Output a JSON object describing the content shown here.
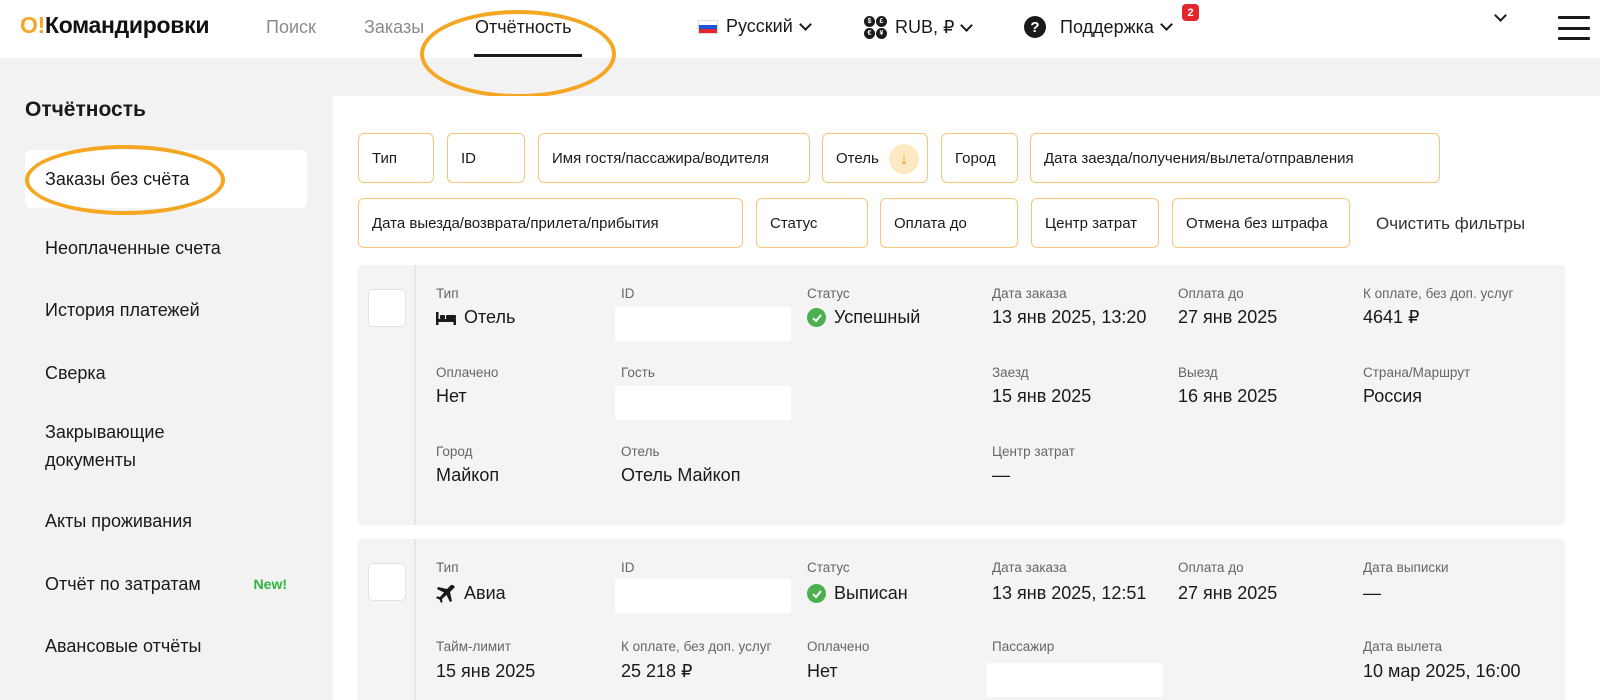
{
  "header": {
    "logo_mark": "О!",
    "logo_text": "Командировки",
    "nav": [
      "Поиск",
      "Заказы",
      "Отчётность"
    ],
    "language": "Русский",
    "currency": "RUB, ₽",
    "support": "Поддержка",
    "support_badge": "2",
    "accent_color": "#f5a623"
  },
  "sidebar": {
    "title": "Отчётность",
    "items": [
      "Заказы без счёта",
      "Неоплаченные счета",
      "История платежей",
      "Сверка",
      "Закрывающие документы",
      "Акты проживания",
      "Отчёт по затратам",
      "Авансовые отчёты"
    ],
    "new_badge": "New!"
  },
  "filters": {
    "row1": [
      "Тип",
      "ID",
      "Имя гостя/пассажира/водителя",
      "Отель",
      "Город",
      "Дата заезда/получения/вылета/отправления"
    ],
    "row2": [
      "Дата выезда/возврата/прилета/прибытия",
      "Статус",
      "Оплата до",
      "Центр затрат",
      "Отмена без штрафа"
    ],
    "clear": "Очистить фильтры"
  },
  "orders": [
    {
      "type_label": "Тип",
      "type": "Отель",
      "type_icon": "bed-icon",
      "id_label": "ID",
      "status_label": "Статус",
      "status": "Успешный",
      "order_date_label": "Дата заказа",
      "order_date": "13 янв 2025, 13:20",
      "pay_until_label": "Оплата до",
      "pay_until": "27 янв 2025",
      "amount_label": "К оплате, без доп. услуг",
      "amount": "4641 ₽",
      "paid_label": "Оплачено",
      "paid": "Нет",
      "guest_label": "Гость",
      "checkin_label": "Заезд",
      "checkin": "15 янв 2025",
      "checkout_label": "Выезд",
      "checkout": "16 янв 2025",
      "country_label": "Страна/Маршрут",
      "country": "Россия",
      "city_label": "Город",
      "city": "Майкоп",
      "hotel_label": "Отель",
      "hotel": "Отель Майкоп",
      "cost_center_label": "Центр затрат",
      "cost_center": "—"
    },
    {
      "type_label": "Тип",
      "type": "Авиа",
      "type_icon": "plane-icon",
      "id_label": "ID",
      "status_label": "Статус",
      "status": "Выписан",
      "order_date_label": "Дата заказа",
      "order_date": "13 янв 2025, 12:51",
      "pay_until_label": "Оплата до",
      "pay_until": "27 янв 2025",
      "issue_date_label": "Дата выписки",
      "issue_date": "—",
      "time_limit_label": "Тайм-лимит",
      "time_limit": "15 янв 2025",
      "amount_label": "К оплате, без доп. услуг",
      "amount": "25 218 ₽",
      "paid_label": "Оплачено",
      "paid": "Нет",
      "passenger_label": "Пассажир",
      "departure_label": "Дата вылета",
      "departure": "10 мар 2025, 16:00"
    }
  ]
}
